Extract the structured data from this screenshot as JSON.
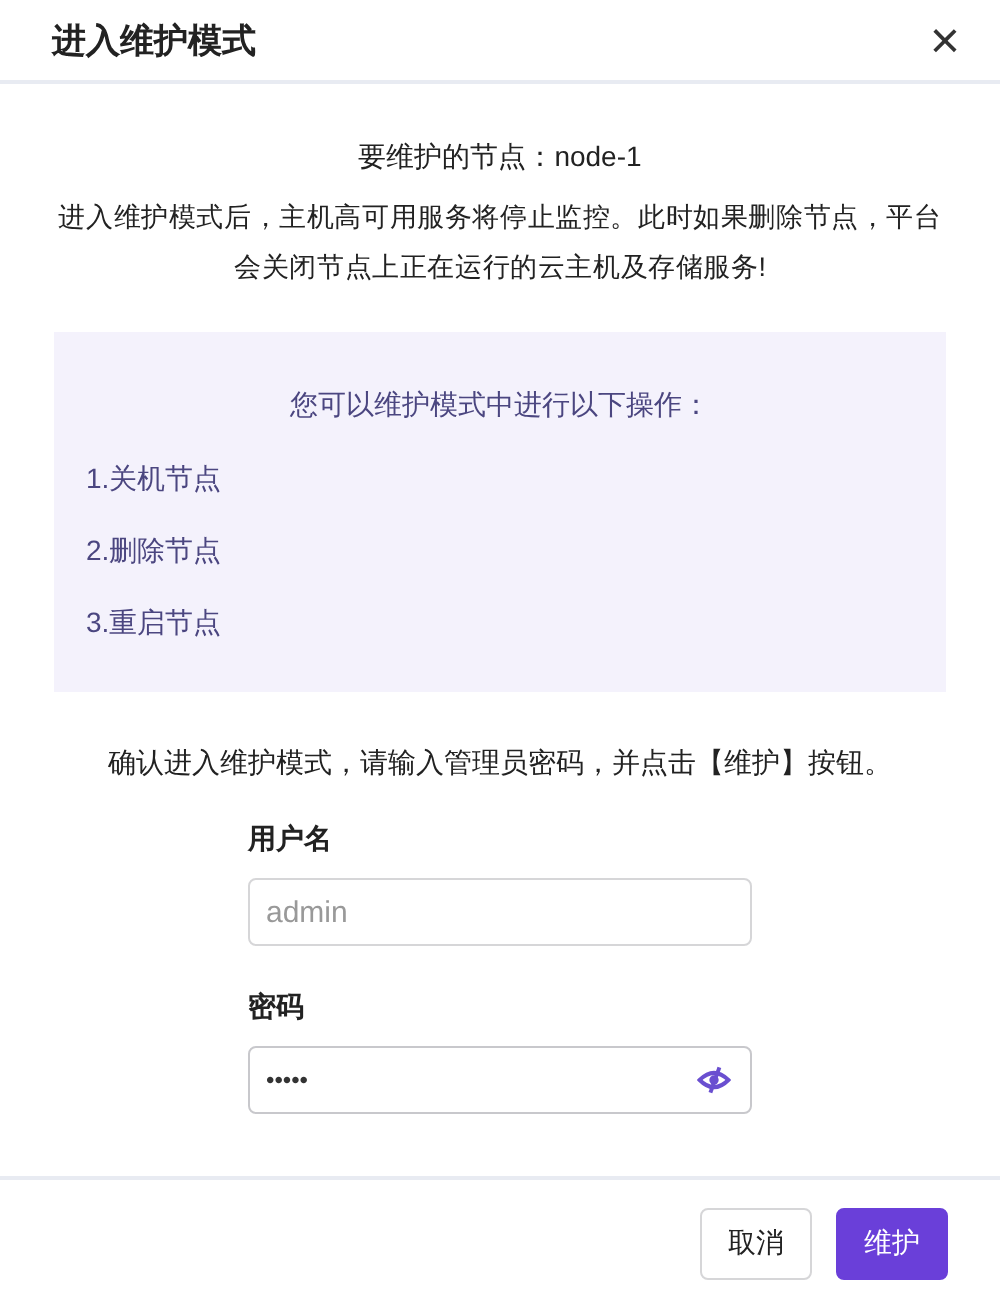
{
  "dialog": {
    "title": "进入维护模式",
    "close": "×"
  },
  "node_line": "要维护的节点：node-1",
  "warning": "进入维护模式后，主机高可用服务将停止监控。此时如果删除节点，平台会关闭节点上正在运行的云主机及存储服务!",
  "operations": {
    "title": "您可以维护模式中进行以下操作：",
    "items": [
      "1.关机节点",
      "2.删除节点",
      "3.重启节点"
    ]
  },
  "confirm_text": "确认进入维护模式，请输入管理员密码，并点击【维护】按钮。",
  "fields": [
    {
      "kind": "text",
      "label": "用户名",
      "placeholder": "admin"
    },
    {
      "kind": "password",
      "label": "密码",
      "value": "•••••"
    }
  ],
  "buttons": [
    {
      "label": "取消",
      "primary": false
    },
    {
      "label": "维护",
      "primary": true
    }
  ]
}
